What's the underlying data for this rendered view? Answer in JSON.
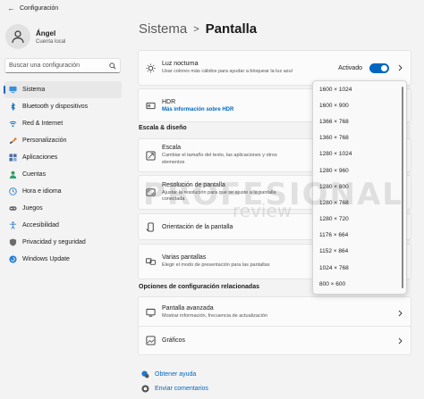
{
  "window": {
    "title": "Configuración"
  },
  "profile": {
    "name": "Ángel",
    "account": "Cuenta local"
  },
  "search": {
    "placeholder": "Buscar una configuración"
  },
  "sidebar": {
    "items": [
      {
        "label": "Sistema",
        "icon": "monitor-icon",
        "active": true
      },
      {
        "label": "Bluetooth y dispositivos",
        "icon": "bluetooth-icon"
      },
      {
        "label": "Red & Internet",
        "icon": "wifi-icon"
      },
      {
        "label": "Personalización",
        "icon": "brush-icon"
      },
      {
        "label": "Aplicaciones",
        "icon": "apps-icon"
      },
      {
        "label": "Cuentas",
        "icon": "person-icon"
      },
      {
        "label": "Hora e idioma",
        "icon": "globe-clock-icon"
      },
      {
        "label": "Juegos",
        "icon": "gamepad-icon"
      },
      {
        "label": "Accesibilidad",
        "icon": "accessibility-icon"
      },
      {
        "label": "Privacidad y seguridad",
        "icon": "shield-icon"
      },
      {
        "label": "Windows Update",
        "icon": "update-icon"
      }
    ]
  },
  "breadcrumb": {
    "parent": "Sistema",
    "separator": ">",
    "current": "Pantalla"
  },
  "cards": {
    "night_light": {
      "title": "Luz nocturna",
      "desc": "Usar colores más cálidos para ayudar a bloquear la luz azul",
      "state": "Activado",
      "on": true
    },
    "hdr": {
      "title": "HDR",
      "link": "Más información sobre HDR"
    },
    "scale": {
      "title": "Escala",
      "desc": "Cambiar el tamaño del texto, las aplicaciones y otros elementos"
    },
    "resolution": {
      "title": "Resolución de pantalla",
      "desc": "Ajustar la resolución para que se ajuste a la pantalla conectada"
    },
    "orientation": {
      "title": "Orientación de la pantalla"
    },
    "multiple": {
      "title": "Varias pantallas",
      "desc": "Elegir el modo de presentación para las pantallas"
    },
    "advanced": {
      "title": "Pantalla avanzada",
      "desc": "Mostrar información, frecuencia de actualización"
    },
    "graphics": {
      "title": "Gráficos"
    }
  },
  "sections": {
    "scale_layout": "Escala & diseño",
    "related": "Opciones de configuración relacionadas"
  },
  "resolution_dropdown": {
    "options": [
      "1600 × 1024",
      "1600 × 900",
      "1366 × 768",
      "1360 × 768",
      "1280 × 1024",
      "1280 × 960",
      "1280 × 800",
      "1280 × 768",
      "1280 × 720",
      "1176 × 664",
      "1152 × 864",
      "1024 × 768",
      "800 × 600"
    ]
  },
  "footer": {
    "help": "Obtener ayuda",
    "feedback": "Enviar comentarios"
  },
  "watermark": {
    "main": "PROFESIONAL",
    "sub": "review"
  },
  "colors": {
    "accent": "#0067c0",
    "background": "#f3f3f3"
  }
}
